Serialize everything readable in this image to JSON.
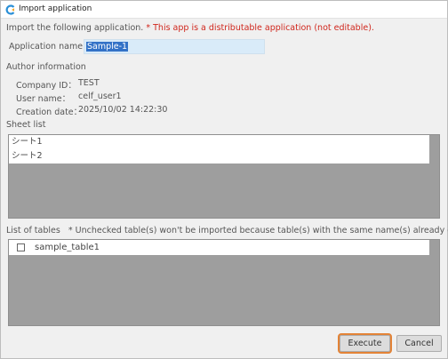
{
  "window": {
    "title": "Import application",
    "icon": "app-logo-icon"
  },
  "intro": {
    "text": "Import the following application.",
    "warning": "* This app is a distributable application (not editable)."
  },
  "app_name": {
    "label": "Application name",
    "value": "Sample-1"
  },
  "author": {
    "heading": "Author information",
    "company_label": "Company ID：",
    "company_value": "TEST",
    "user_label": "User name：",
    "user_value": "celf_user1",
    "created_label": "Creation date：",
    "created_value": "2025/10/02 14:22:30"
  },
  "sheet_list": {
    "heading": "Sheet list",
    "items": [
      "シート1",
      "シート2"
    ]
  },
  "tables": {
    "heading": "List of tables",
    "note": "* Unchecked table(s) won't be imported because table(s) with the same name(s) already exist.",
    "items": [
      {
        "label": "sample_table1",
        "checked": false
      }
    ]
  },
  "buttons": {
    "execute": "Execute",
    "cancel": "Cancel"
  },
  "colors": {
    "warning": "#d0261c",
    "selection": "#3372c7",
    "focus_ring": "#e38336",
    "list_bg": "#9e9e9e"
  }
}
